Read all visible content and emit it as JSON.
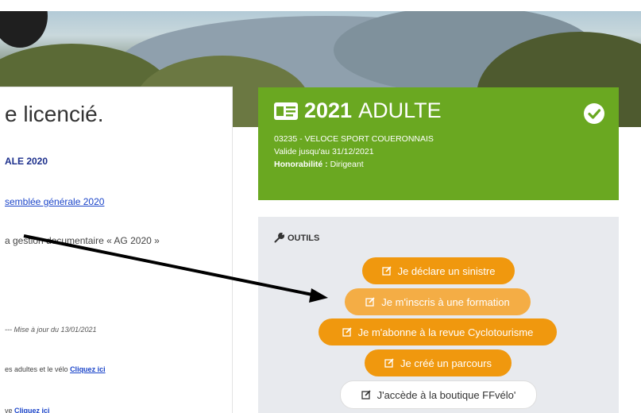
{
  "left": {
    "title": "e licencié.",
    "link_bold": "ALE 2020",
    "link_assembly": "semblée générale 2020",
    "text_docs": "a gestion documentaire « AG 2020 »",
    "update_note": "--- Mise à jour du 13/01/2021",
    "adults_text": "es adultes et le vélo ",
    "adults_link": "Cliquez ici",
    "last_text": "ve ",
    "last_link": "Cliquez ici"
  },
  "license": {
    "year": "2021",
    "category": "ADULTE",
    "club": "03235 - VELOCE SPORT COUERONNAIS",
    "valid": "Valide jusqu'au 31/12/2021",
    "honor_label": "Honorabilité :",
    "honor_value": "Dirigeant",
    "card_color": "#6aa821"
  },
  "tools": {
    "title": "OUTILS",
    "buttons": [
      {
        "label": "Je déclare un sinistre"
      },
      {
        "label": "Je m'inscris à une formation"
      },
      {
        "label": "Je m'abonne à la revue Cyclotourisme"
      },
      {
        "label": "Je créé un parcours"
      },
      {
        "label": "J'accède à la boutique FFvélo'"
      }
    ],
    "accent": "#f0980e"
  },
  "icons": {
    "id_card": "id-card-icon",
    "check": "check-circle-icon",
    "wrench": "wrench-icon",
    "edit": "edit-icon"
  }
}
